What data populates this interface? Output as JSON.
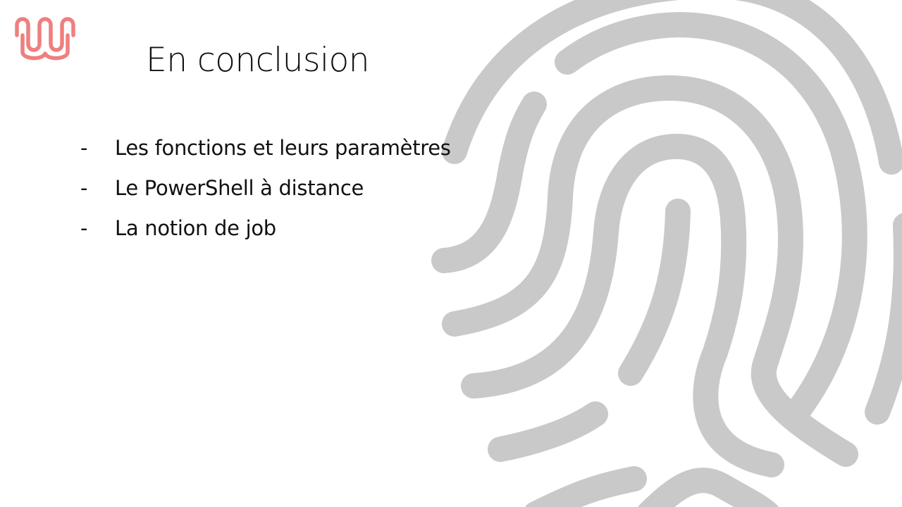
{
  "slide": {
    "title": "En conclusion",
    "bullet_marker": "-",
    "bullets": [
      "Les fonctions et leurs paramètres",
      "Le PowerShell à distance",
      "La notion de job"
    ]
  },
  "logo": {
    "icon": "wave-logo-icon",
    "color": "#ef7f7f"
  },
  "background": {
    "icon": "fingerprint-icon",
    "color": "#c9c9c9"
  }
}
